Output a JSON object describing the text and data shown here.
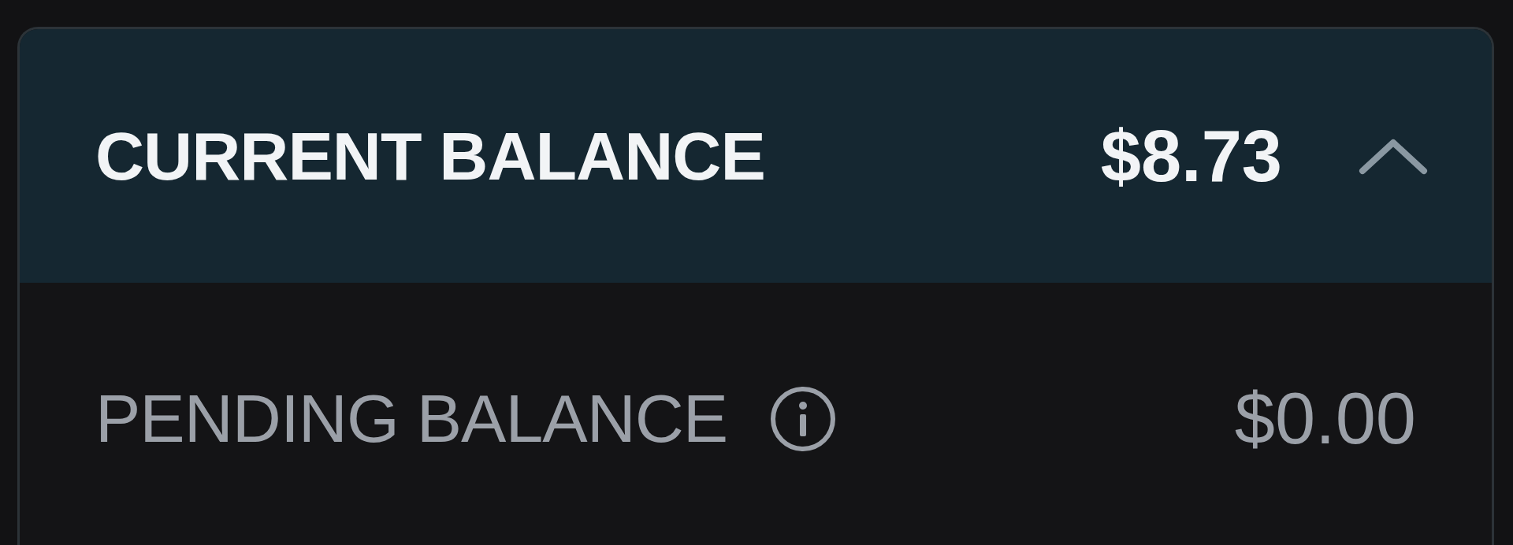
{
  "balance_card": {
    "current": {
      "label": "CURRENT BALANCE",
      "amount": "$8.73",
      "expanded": true
    },
    "pending": {
      "label": "PENDING BALANCE",
      "amount": "$0.00"
    }
  }
}
